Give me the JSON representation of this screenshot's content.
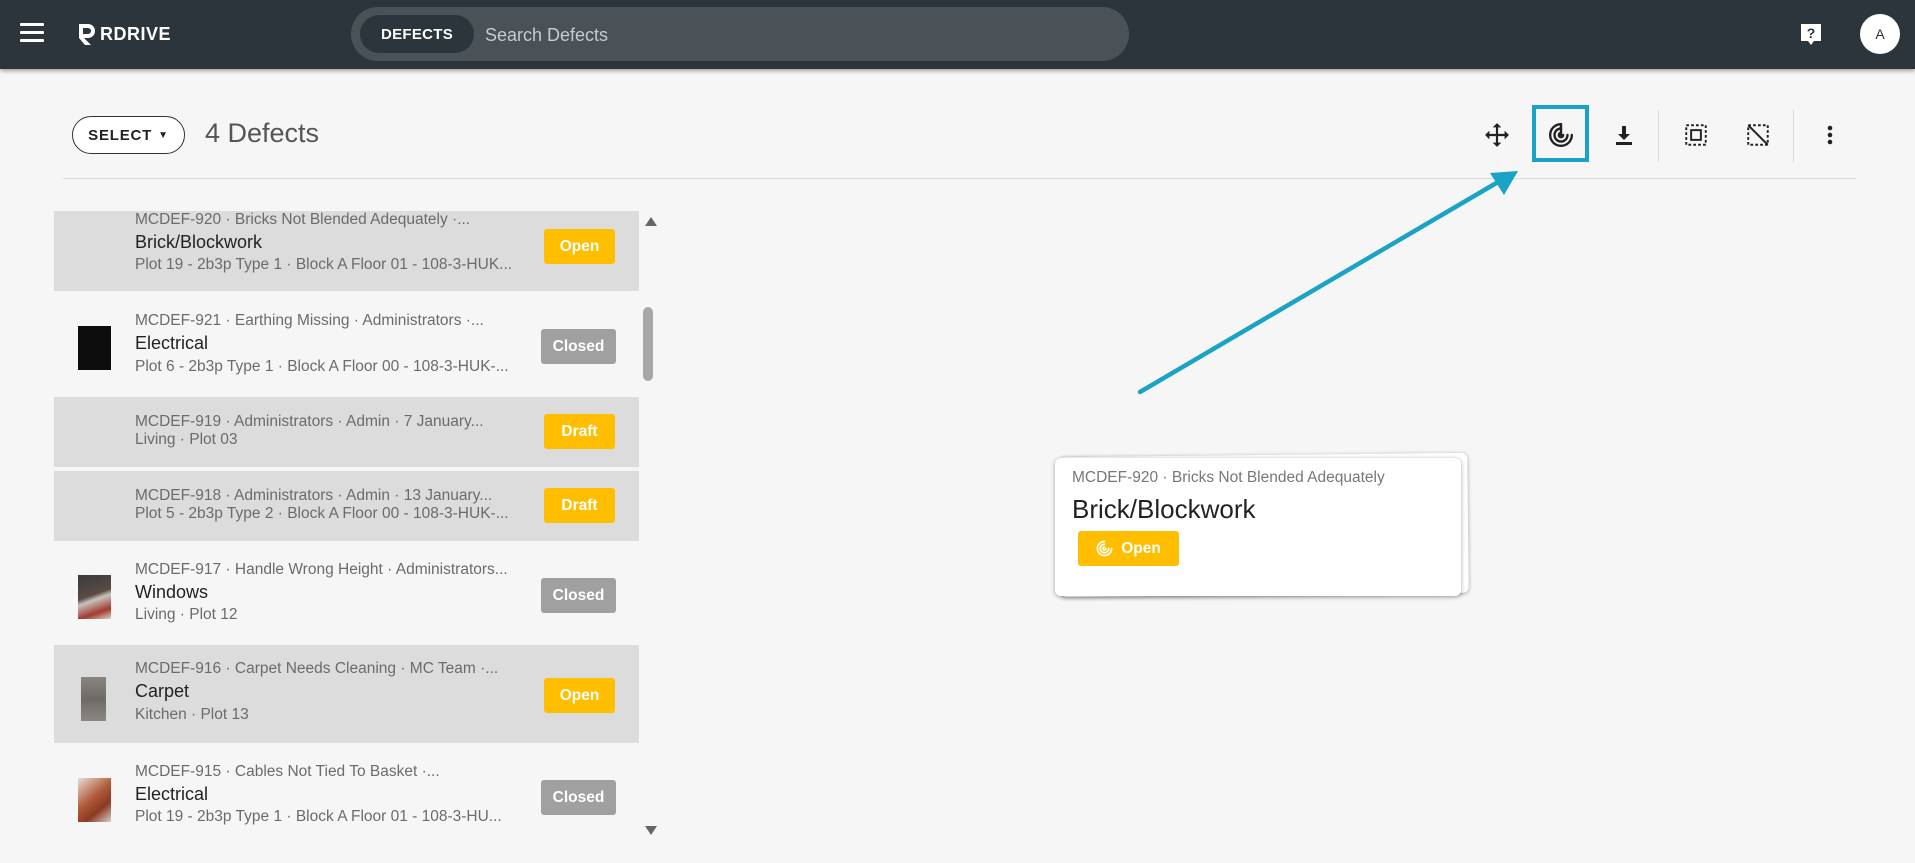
{
  "app": {
    "logo_text": "RDRIVE",
    "search": {
      "chip_label": "DEFECTS",
      "placeholder": "Search Defects"
    },
    "avatar_initial": "A",
    "colors": {
      "topbar": "#2b353b",
      "accent_highlight": "#1aa3c4",
      "open": "#ffbf00",
      "draft": "#ffbf00",
      "closed": "#a0a0a0"
    }
  },
  "header": {
    "select_label": "SELECT",
    "count_label": "4 Defects",
    "toolbar_icons": [
      "move-icon",
      "target-locate-icon",
      "download-icon",
      "select-area-icon",
      "deselect-area-icon",
      "more-vert-icon"
    ]
  },
  "defects": [
    {
      "meta": "MCDEF-920 · Bricks Not Blended Adequately ·...",
      "title": "Brick/Blockwork",
      "location": "Plot 19 - 2b3p Type 1 · Block A Floor 01 - 108-3-HUK...",
      "status": "Open"
    },
    {
      "meta": "MCDEF-921 · Earthing Missing · Administrators ·...",
      "title": "Electrical",
      "location": "Plot 6 - 2b3p Type 1 · Block A Floor 00 - 108-3-HUK-...",
      "status": "Closed"
    },
    {
      "meta": "MCDEF-919 · Administrators · Admin · 7 January...",
      "title": "",
      "location": "Living · Plot 03",
      "status": "Draft"
    },
    {
      "meta": "MCDEF-918 · Administrators · Admin · 13 January...",
      "title": "",
      "location": "Plot 5 - 2b3p Type 2 · Block A Floor 00 - 108-3-HUK-...",
      "status": "Draft"
    },
    {
      "meta": "MCDEF-917 · Handle Wrong Height · Administrators...",
      "title": "Windows",
      "location": "Living · Plot 12",
      "status": "Closed"
    },
    {
      "meta": "MCDEF-916 · Carpet Needs Cleaning · MC Team ·...",
      "title": "Carpet",
      "location": "Kitchen · Plot 13",
      "status": "Open"
    },
    {
      "meta": "MCDEF-915 · Cables Not Tied To Basket ·...",
      "title": "Electrical",
      "location": "Plot 19 - 2b3p Type 1 · Block A Floor 01 - 108-3-HU...",
      "status": "Closed"
    }
  ],
  "map_card": {
    "meta": "MCDEF-920 · Bricks Not Blended Adequately",
    "title": "Brick/Blockwork",
    "status": "Open"
  }
}
